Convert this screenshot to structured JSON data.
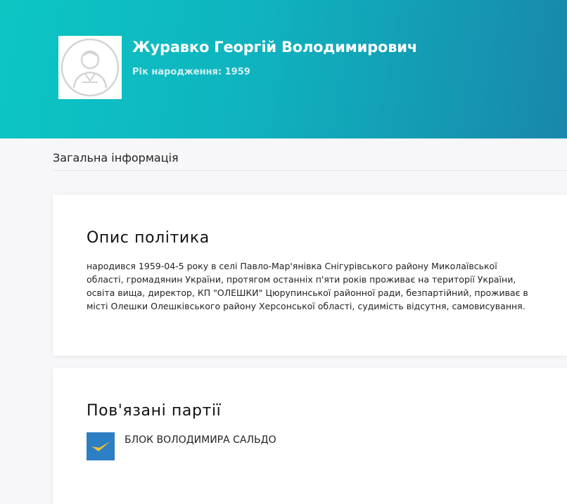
{
  "profile": {
    "name": "Журавко Георгій Володимирович",
    "birth_year_line": "Рік народження: 1959",
    "avatar_icon": "user-avatar-placeholder-icon"
  },
  "section": {
    "title": "Загальна інформація"
  },
  "bio_card": {
    "heading": "Опис політика",
    "text": "народився 1959-04-5 року в селі Павло-Мар'янівка Снігурівського району Миколаївської області, громадянин України, протягом останніх п'яти років проживає на території України, освіта вища, директор, КП \"ОЛЕШКИ\" Цюрупинської районної ради, безпартійний, проживає в місті Олешки Олешківського району Херсонської області, судимість відсутня, самовисування."
  },
  "parties_card": {
    "heading": "Пов'язані партії",
    "items": [
      {
        "name": "БЛОК ВОЛОДИМИРА САЛЬДО",
        "logo_icon": "party-logo-checkmark-icon"
      }
    ]
  },
  "colors": {
    "header_start": "#0cc6c4",
    "header_end": "#1987ab",
    "party_logo_bg": "#2d7fc4",
    "party_logo_check": "#f2c230"
  }
}
